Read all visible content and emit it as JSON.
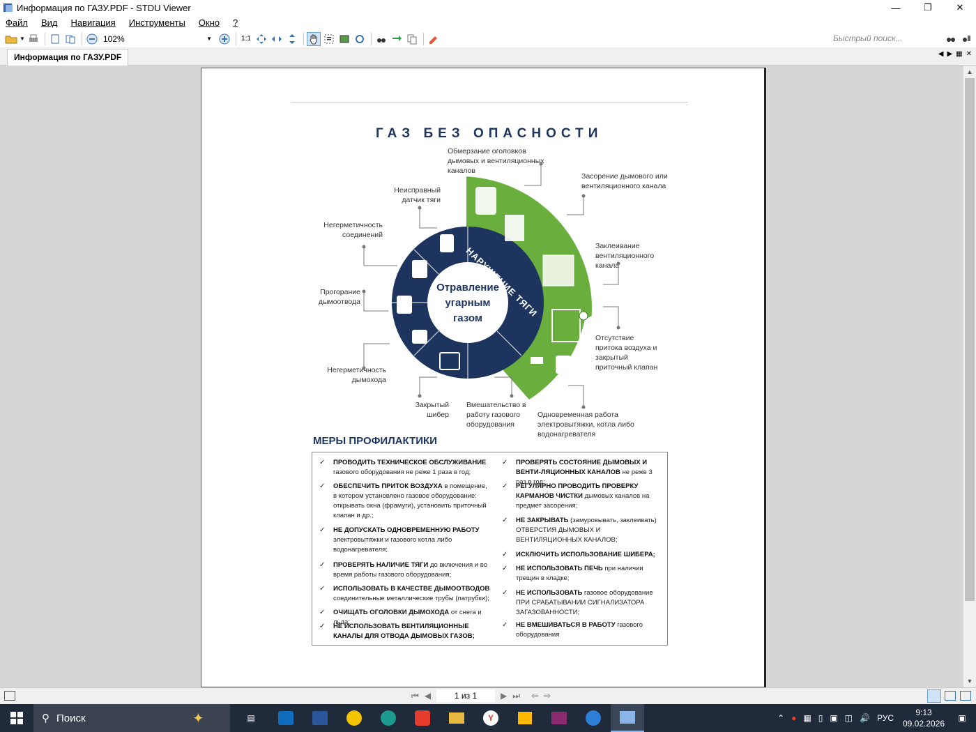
{
  "window": {
    "title": "Информация по ГАЗУ.PDF - STDU Viewer"
  },
  "menu": [
    "Файл",
    "Вид",
    "Навигация",
    "Инструменты",
    "Окно",
    "?"
  ],
  "toolbar": {
    "zoom": "102%",
    "quick_search_placeholder": "Быстрый поиск..."
  },
  "tab": {
    "label": "Информация по ГАЗУ.PDF"
  },
  "statusbar": {
    "page_indicator": "1 из 1"
  },
  "document": {
    "title": "ГАЗ БЕЗ ОПАСНОСТИ",
    "center": [
      "Отравление",
      "угарным",
      "газом"
    ],
    "arc_label": "НАРУШЕНИЕ ТЯГИ",
    "labels": {
      "l1": "Обмерзание оголовков дымовых и вентиляционных каналов",
      "l2": "Засорение дымового или вентиляционного канала",
      "l3": "Заклеивание вентиляционного канала",
      "l4": "Отсутствие притока воздуха и закрытый приточный клапан",
      "l5": "Одновременная работа электровытяжки, котла либо водонагревателя",
      "l6": "Вмешательство в работу газового оборудования",
      "l7": "Закрытый шибер",
      "l8": "Негерметичность дымохода",
      "l9": "Прогорание дымоотвода",
      "l10": "Негерметичность соединений",
      "l11": "Неисправный датчик тяги"
    },
    "measures_title": "МЕРЫ ПРОФИЛАКТИКИ",
    "measures_left": [
      {
        "bold": "ПРОВОДИТЬ ТЕХНИЧЕСКОЕ ОБСЛУЖИВАНИЕ",
        "rest": "газового оборудования  не реже 1 раза в год;"
      },
      {
        "bold": "ОБЕСПЕЧИТЬ ПРИТОК ВОЗДУХА",
        "rest": "в помещение, в котором установлено газовое оборудование: открывать окна (фрамуги), установить приточный клапан и др.;"
      },
      {
        "bold": "НЕ ДОПУСКАТЬ ОДНОВРЕМЕННУЮ РАБОТУ",
        "rest": "электровытяжки и газового котла либо водонагревателя;"
      },
      {
        "bold": "ПРОВЕРЯТЬ  НАЛИЧИЕ ТЯГИ",
        "rest": "до включения и во время работы газового оборудования;"
      },
      {
        "bold": "ИСПОЛЬЗОВАТЬ В КАЧЕСТВЕ ДЫМООТВОДОВ",
        "rest": "соединительные металлические трубы (патрубки);"
      },
      {
        "bold": "ОЧИЩАТЬ ОГОЛОВКИ ДЫМОХОДА",
        "rest": "от снега и льда;"
      },
      {
        "bold": "НЕ ИСПОЛЬЗОВАТЬ ВЕНТИЛЯЦИОННЫЕ КАНАЛЫ ДЛЯ ОТВОДА ДЫМОВЫХ ГАЗОВ;",
        "rest": ""
      }
    ],
    "measures_right": [
      {
        "bold": "ПРОВЕРЯТЬ СОСТОЯНИЕ ДЫМОВЫХ  И ВЕНТИ-ЛЯЦИОННЫХ КАНАЛОВ",
        "rest": "не реже 3 раз в год;"
      },
      {
        "bold": "РЕГУЛЯРНО ПРОВОДИТЬ ПРОВЕРКУ КАРМАНОВ ЧИСТКИ",
        "rest": "дымовых каналов на предмет засорения;"
      },
      {
        "bold": "НЕ ЗАКРЫВАТЬ",
        "rest": "(замуровывать, заклеивать) ОТВЕРСТИЯ ДЫМОВЫХ И ВЕНТИЛЯЦИОННЫХ КАНАЛОВ;"
      },
      {
        "bold": "ИСКЛЮЧИТЬ ИСПОЛЬЗОВАНИЕ ШИБЕРА;",
        "rest": ""
      },
      {
        "bold": "НЕ ИСПОЛЬЗОВАТЬ ПЕЧЬ",
        "rest": "при наличии трещин в кладке;"
      },
      {
        "bold": "НЕ ИСПОЛЬЗОВАТЬ",
        "rest": "газовое оборудование ПРИ СРАБАТЫВАНИИ СИГНАЛИЗАТОРА ЗАГАЗОВАННОСТИ;"
      },
      {
        "bold": "НЕ ВМЕШИВАТЬСЯ В РАБОТУ",
        "rest": "газового оборудования"
      }
    ]
  },
  "taskbar": {
    "search": "Поиск",
    "lang": "РУС",
    "time": "9:13",
    "date": "09.02.2026"
  },
  "colors": {
    "navy": "#1d355e",
    "green": "#6aaf3d",
    "accent": "#0078d7"
  }
}
